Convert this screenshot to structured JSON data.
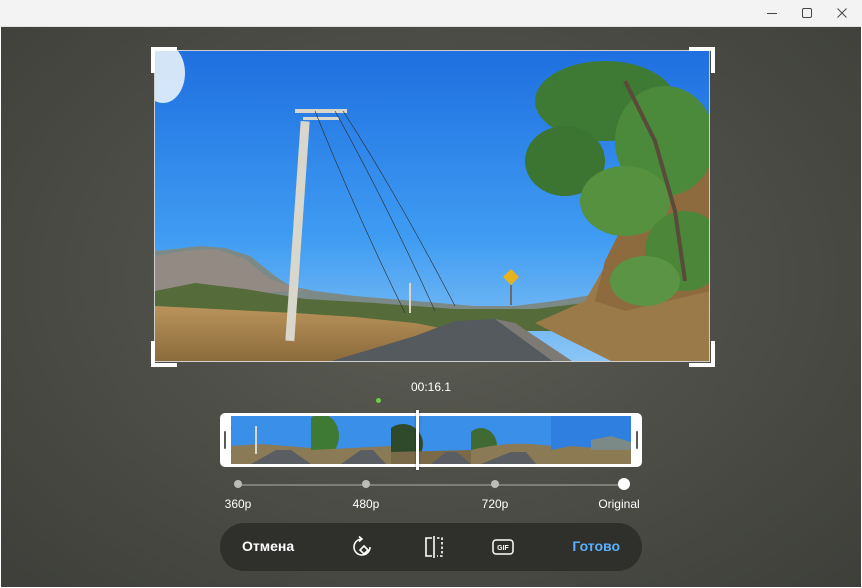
{
  "editor": {
    "timestamp": "00:16.1",
    "resolutions": [
      {
        "label": "360p"
      },
      {
        "label": "480p"
      },
      {
        "label": "720p"
      },
      {
        "label": "Original",
        "selected": true
      }
    ],
    "toolbar": {
      "cancel_label": "Отмена",
      "done_label": "Готово",
      "icons": [
        "rotate-icon",
        "flip-icon",
        "gif-icon"
      ],
      "gif_text": "GIF"
    }
  },
  "colors": {
    "accent": "#5ab0ff",
    "background": "#4e4f48",
    "toolbar": "#2f302c"
  }
}
